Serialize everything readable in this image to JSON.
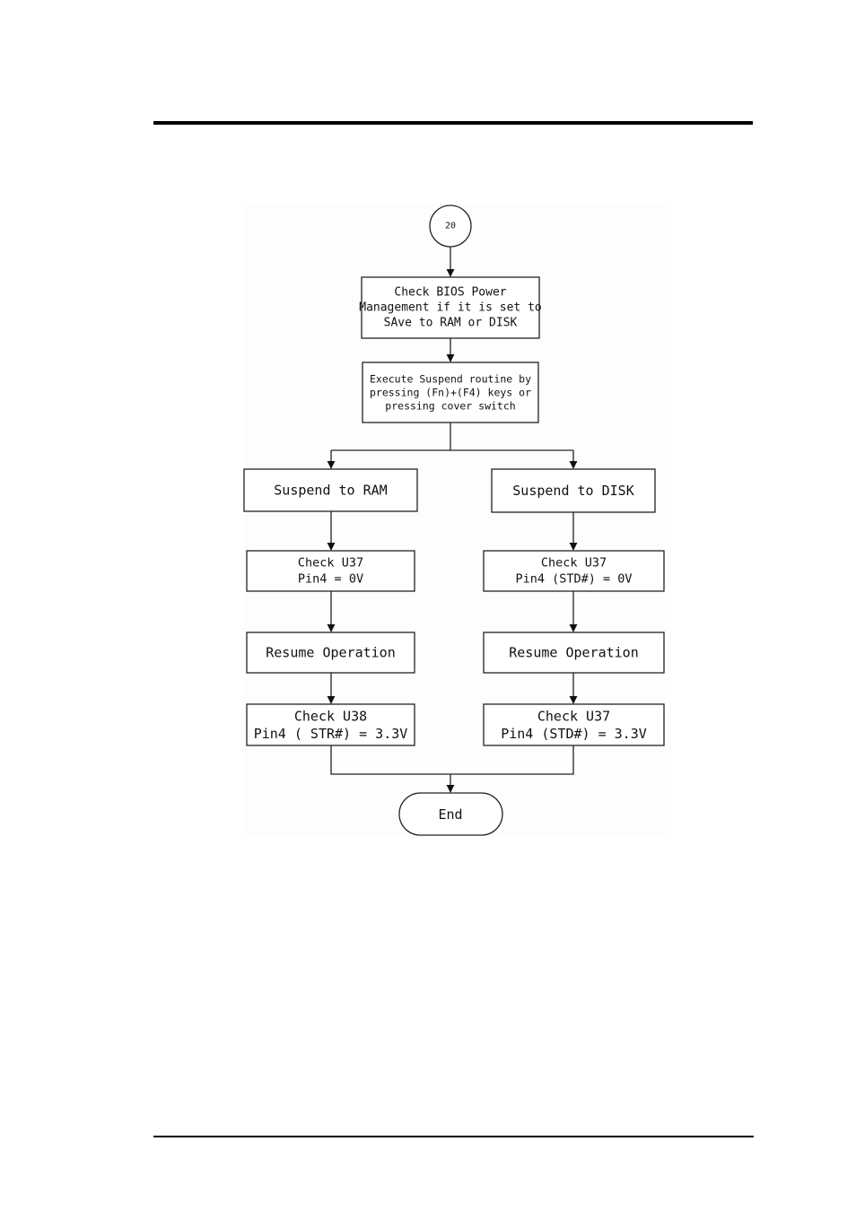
{
  "page": {
    "header_rule": true,
    "footer_rule": true
  },
  "flowchart": {
    "start": {
      "label": "20",
      "shape": "circle"
    },
    "steps": [
      {
        "id": "check-bios",
        "lines": [
          "Check BIOS Power",
          "Management if it is set to",
          "SAve to RAM or DISK"
        ]
      },
      {
        "id": "execute-suspend",
        "lines": [
          "Execute Suspend routine by",
          "pressing (Fn)+(F4) keys or",
          "  pressing cover switch"
        ]
      }
    ],
    "branches": {
      "left": [
        {
          "id": "suspend-ram",
          "lines": [
            "Suspend to RAM"
          ]
        },
        {
          "id": "check-u37-left",
          "lines": [
            "Check U37",
            "Pin4 = 0V"
          ]
        },
        {
          "id": "resume-left",
          "lines": [
            "Resume Operation"
          ]
        },
        {
          "id": "check-u38",
          "lines": [
            "Check U38",
            "Pin4 ( STR#) = 3.3V"
          ]
        }
      ],
      "right": [
        {
          "id": "suspend-disk",
          "lines": [
            "Suspend to DISK"
          ]
        },
        {
          "id": "check-u37-right",
          "lines": [
            "Check U37",
            "Pin4 (STD#) = 0V"
          ]
        },
        {
          "id": "resume-right",
          "lines": [
            "Resume Operation"
          ]
        },
        {
          "id": "check-u37-final",
          "lines": [
            "Check U37",
            "Pin4 (STD#) = 3.3V"
          ]
        }
      ]
    },
    "end": {
      "label": "End",
      "shape": "terminator"
    }
  }
}
